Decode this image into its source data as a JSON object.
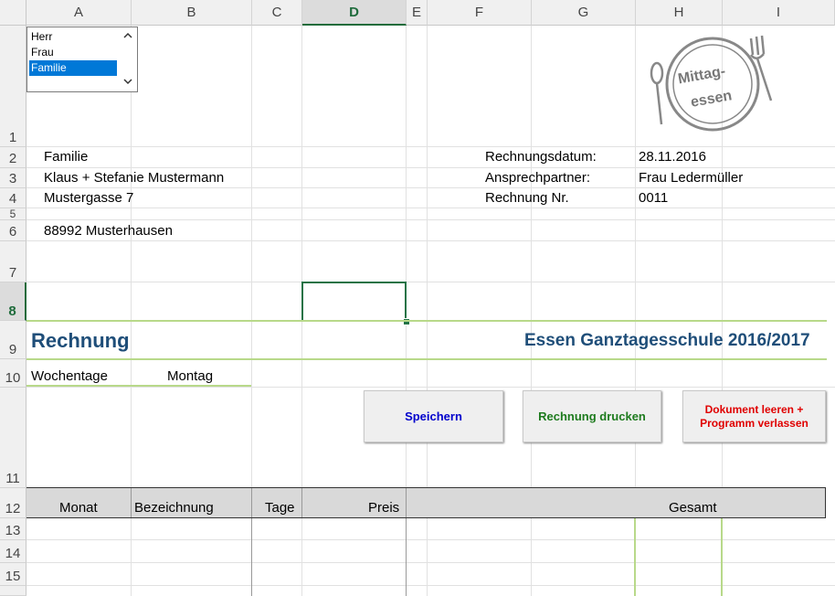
{
  "columns": [
    "A",
    "B",
    "C",
    "D",
    "E",
    "F",
    "G",
    "H",
    "I"
  ],
  "rows": [
    "1",
    "2",
    "3",
    "4",
    "5",
    "6",
    "7",
    "8",
    "9",
    "10",
    "11",
    "12",
    "13",
    "14",
    "15"
  ],
  "listbox": {
    "items": [
      "Herr",
      "Frau",
      "Familie"
    ],
    "selected": "Familie"
  },
  "logo": {
    "line1": "Mittag-",
    "line2": "essen"
  },
  "address": {
    "salutation": "Familie",
    "name": "Klaus + Stefanie Mustermann",
    "street": "Mustergasse 7",
    "city": "88992 Musterhausen"
  },
  "info": {
    "date_label": "Rechnungsdatum:",
    "date_value": "28.11.2016",
    "contact_label": "Ansprechpartner:",
    "contact_value": "Frau Ledermüller",
    "invoice_label": "Rechnung Nr.",
    "invoice_value": "0011"
  },
  "title": "Rechnung",
  "subtitle": "Essen Ganztagesschule 2016/2017",
  "weekdays": {
    "label": "Wochentage",
    "value": "Montag"
  },
  "buttons": {
    "save": "Speichern",
    "print": "Rechnung drucken",
    "clear_line1": "Dokument leeren +",
    "clear_line2": "Programm verlassen"
  },
  "table": {
    "headers": [
      "Monat",
      "Bezeichnung",
      "Tage",
      "Preis",
      "Gesamt"
    ]
  },
  "colors": {
    "title": "#1f4e79",
    "save": "#0000cc",
    "print": "#1e7b1e",
    "clear": "#e00000",
    "accent_green": "#217346"
  }
}
